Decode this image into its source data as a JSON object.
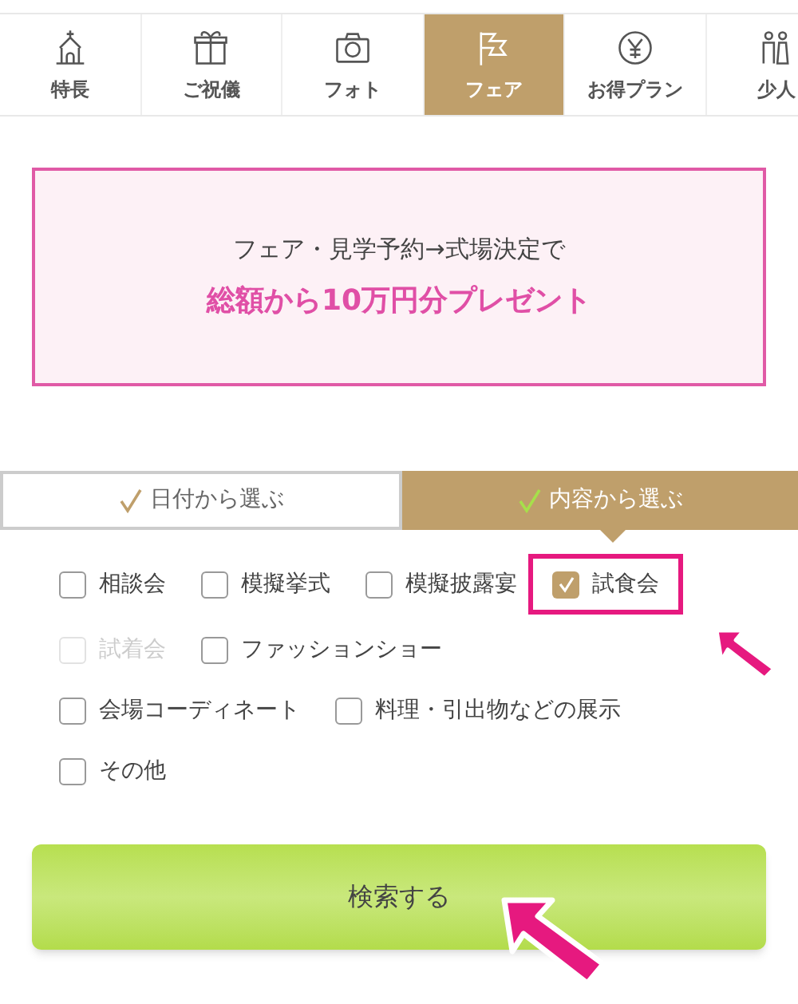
{
  "nav_tabs": [
    {
      "label": "特長",
      "selected": false
    },
    {
      "label": "ご祝儀",
      "selected": false
    },
    {
      "label": "フォト",
      "selected": false
    },
    {
      "label": "フェア",
      "selected": true
    },
    {
      "label": "お得プラン",
      "selected": false
    },
    {
      "label": "少人",
      "selected": false
    }
  ],
  "promo": {
    "line_1": "フェア・見学予約→式場決定で",
    "line_2": "総額から10万円分プレゼント"
  },
  "mode_tabs": [
    {
      "label": "日付から選ぶ",
      "selected": false
    },
    {
      "label": "内容から選ぶ",
      "selected": true
    }
  ],
  "option_rows": [
    [
      {
        "label": "相談会",
        "checked": false,
        "disabled": false,
        "highlighted": false
      },
      {
        "label": "模擬挙式",
        "checked": false,
        "disabled": false,
        "highlighted": false
      },
      {
        "label": "模擬披露宴",
        "checked": false,
        "disabled": false,
        "highlighted": false
      },
      {
        "label": "試食会",
        "checked": true,
        "disabled": false,
        "highlighted": true
      }
    ],
    [
      {
        "label": "試着会",
        "checked": false,
        "disabled": true,
        "highlighted": false
      },
      {
        "label": "ファッションショー",
        "checked": false,
        "disabled": false,
        "highlighted": false
      }
    ],
    [
      {
        "label": "会場コーディネート",
        "checked": false,
        "disabled": false,
        "highlighted": false
      },
      {
        "label": "料理・引出物などの展示",
        "checked": false,
        "disabled": false,
        "highlighted": false
      }
    ],
    [
      {
        "label": "その他",
        "checked": false,
        "disabled": false,
        "highlighted": false
      }
    ]
  ],
  "search_button": {
    "label": "検索する"
  }
}
